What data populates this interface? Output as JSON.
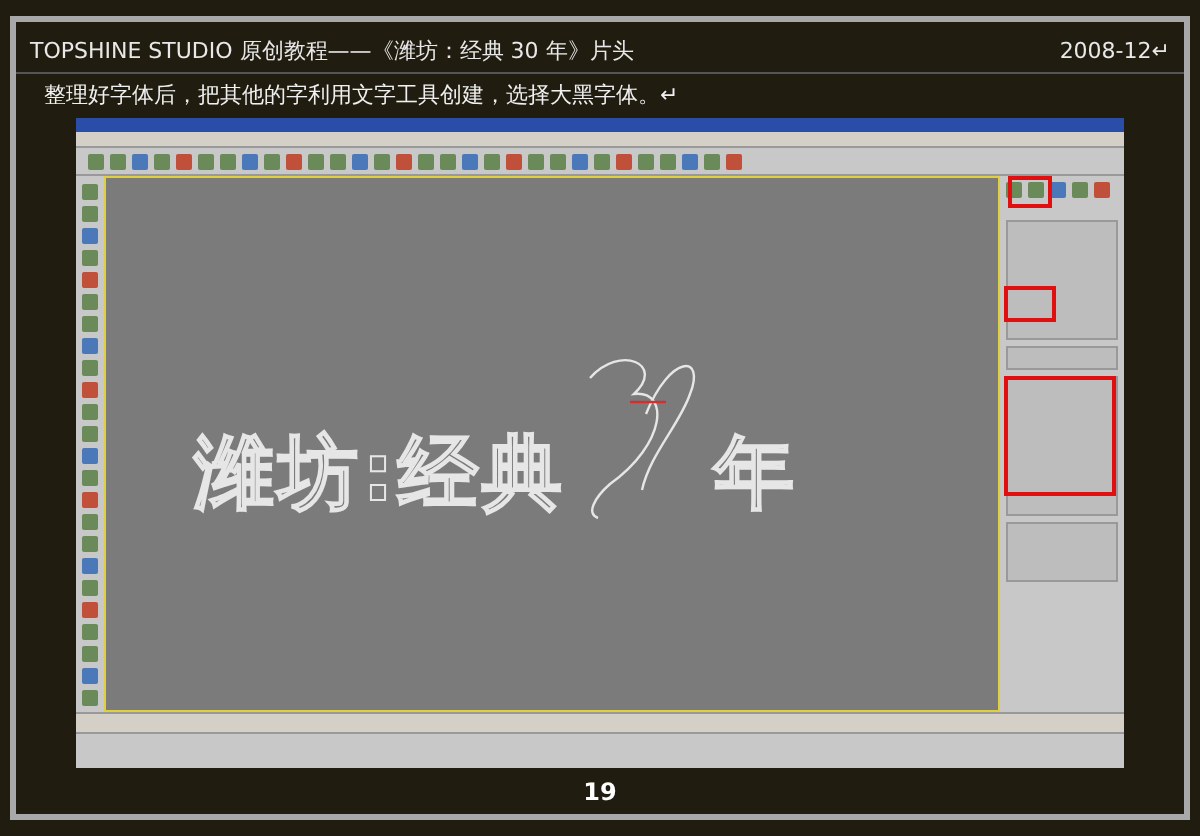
{
  "header": {
    "title": "TOPSHINE STUDIO 原创教程——《潍坊：经典 30 年》片头",
    "date": "2008-12↵"
  },
  "instruction": "整理好字体后，把其他的字利用文字工具创建，选择大黑字体。↵",
  "screenshot": {
    "viewport_text": [
      "潍坊:经典",
      "年"
    ]
  },
  "page_number": "19"
}
